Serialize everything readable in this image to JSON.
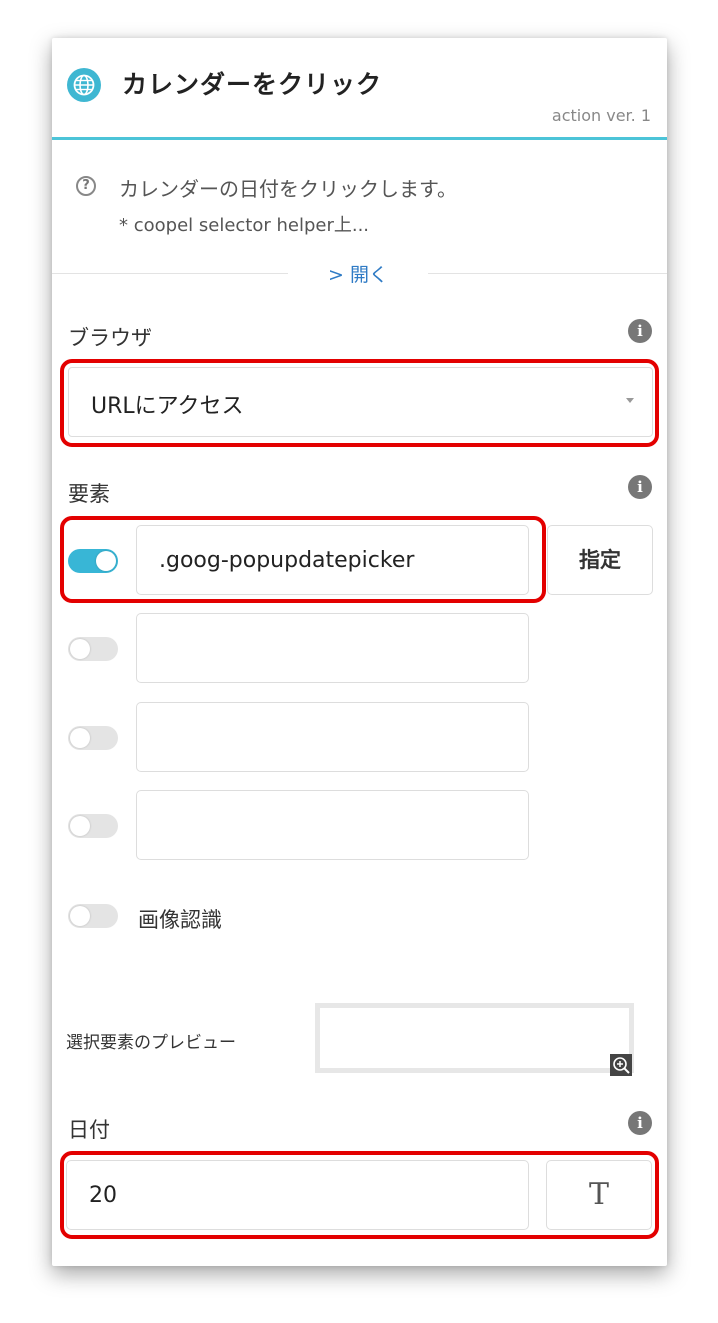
{
  "header": {
    "icon": "globe-icon",
    "title": "カレンダーをクリック",
    "version": "action ver. 1"
  },
  "description": {
    "icon": "help-circle-icon",
    "line1": "カレンダーの日付をクリックします。",
    "line2": "* coopel selector helper上...",
    "open_label": "> 開く"
  },
  "browser": {
    "label": "ブラウザ",
    "selected": "URLにアクセス"
  },
  "elements": {
    "label": "要素",
    "rows": [
      {
        "enabled": true,
        "value": ".goog-popupdatepicker"
      },
      {
        "enabled": false,
        "value": ""
      },
      {
        "enabled": false,
        "value": ""
      },
      {
        "enabled": false,
        "value": ""
      }
    ],
    "specify_label": "指定",
    "image_recognition_label": "画像認識",
    "image_recognition_enabled": false
  },
  "preview": {
    "label": "選択要素のプレビュー"
  },
  "date": {
    "label": "日付",
    "value": "20",
    "type_button_label": "T"
  },
  "colors": {
    "accent": "#38b6d6",
    "highlight": "#e30000"
  }
}
